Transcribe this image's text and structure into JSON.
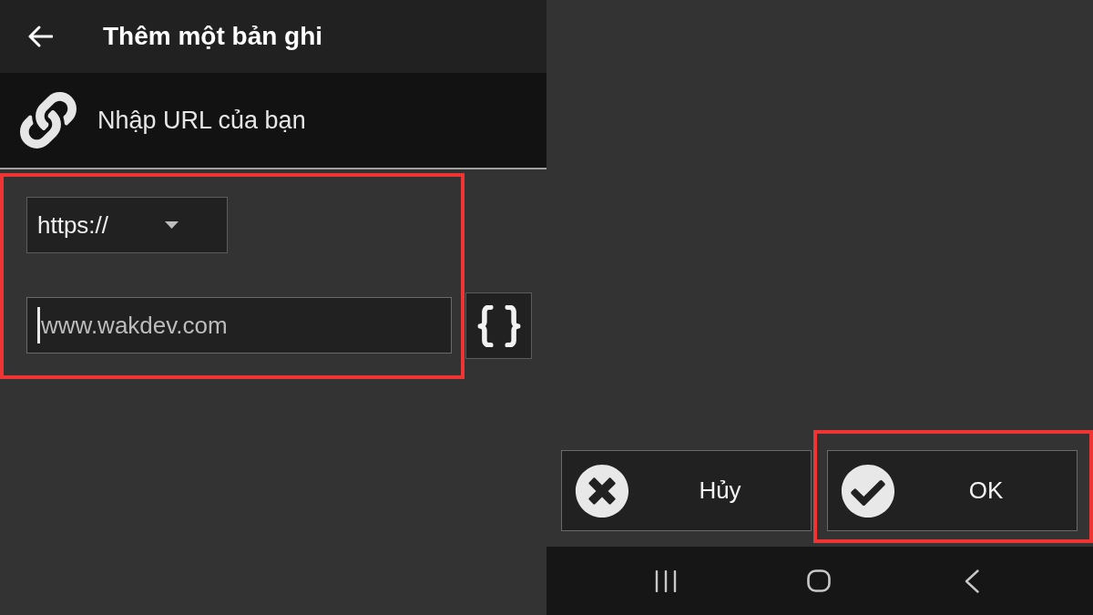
{
  "left_screen": {
    "app_bar": {
      "title": "Thêm một bản ghi"
    },
    "url_hint": {
      "text": "Nhập URL của bạn"
    },
    "url_form": {
      "highlighted": true,
      "scheme_dropdown": {
        "value": "https://"
      },
      "url_field": {
        "placeholder": "www.wakdev.com",
        "focused": true
      }
    }
  },
  "right_screen": {
    "buttons": [
      {
        "kind": "cancel",
        "label": "Hủy",
        "highlighted": false
      },
      {
        "kind": "confirm",
        "label": "OK",
        "highlighted": true
      }
    ]
  }
}
